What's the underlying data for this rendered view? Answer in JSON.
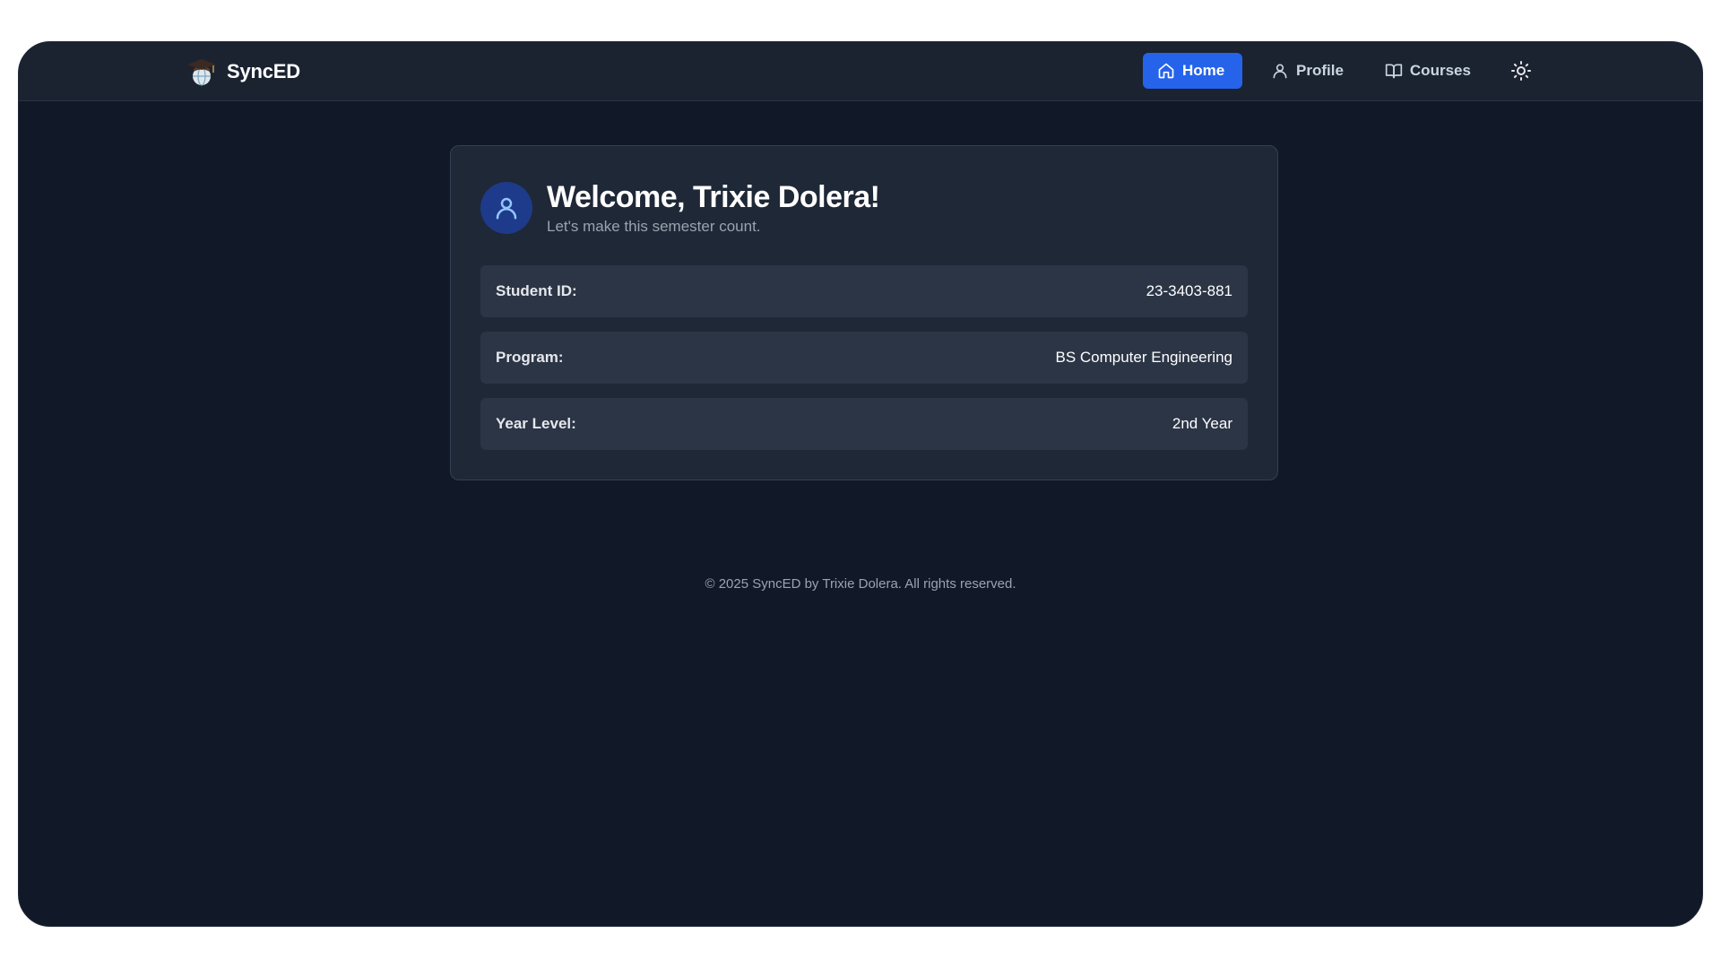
{
  "navbar": {
    "brand": "SyncED",
    "logo_icon": "graduation-cap-globe-icon",
    "items": [
      {
        "label": "Home",
        "icon": "home-icon",
        "active": true
      },
      {
        "label": "Profile",
        "icon": "user-icon",
        "active": false
      },
      {
        "label": "Courses",
        "icon": "book-open-icon",
        "active": false
      }
    ],
    "theme_toggle_icon": "sun-icon"
  },
  "welcome": {
    "title": "Welcome, Trixie Dolera!",
    "subtitle": "Let's make this semester count.",
    "avatar_icon": "user-icon"
  },
  "info": [
    {
      "label": "Student ID:",
      "value": "23-3403-881"
    },
    {
      "label": "Program:",
      "value": "BS Computer Engineering"
    },
    {
      "label": "Year Level:",
      "value": "2nd Year"
    }
  ],
  "footer": {
    "text": "© 2025 SyncED by Trixie Dolera. All rights reserved."
  },
  "colors": {
    "background": "#111827",
    "navbar": "#1b2331",
    "card": "#1f2837",
    "row": "#2b3545",
    "accent": "#2563eb"
  }
}
